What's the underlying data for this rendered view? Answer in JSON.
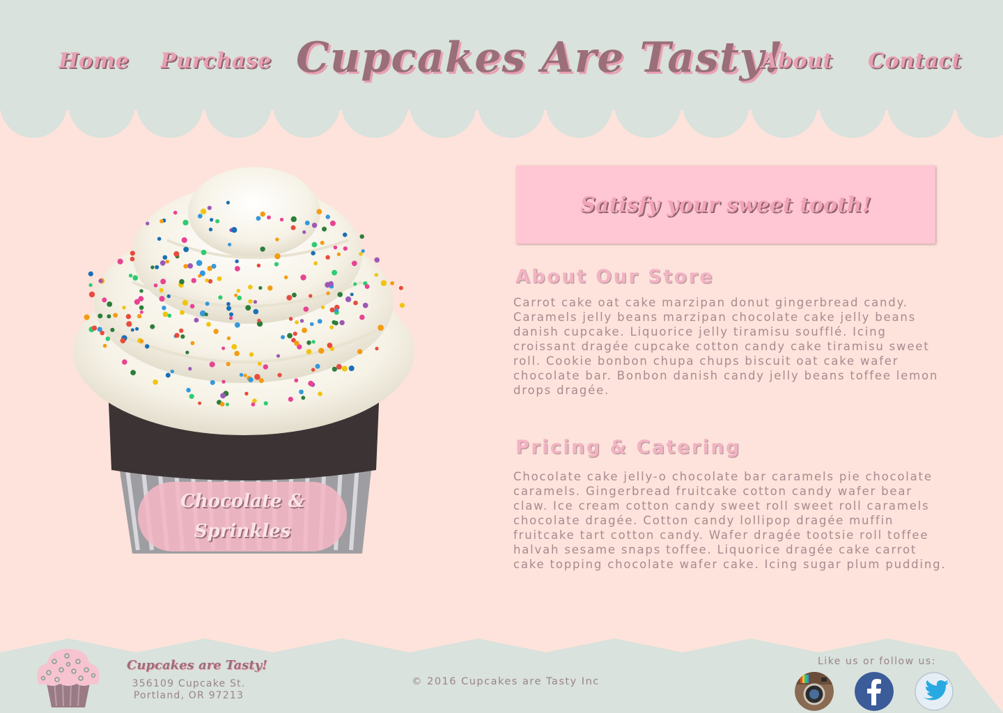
{
  "nav": {
    "home": "Home",
    "purchase": "Purchase",
    "about": "About",
    "contact": "Contact"
  },
  "site_title": "Cupcakes Are Tasty!",
  "hero": {
    "caption_line1": "Chocolate &",
    "caption_line2": "Sprinkles"
  },
  "banner_text": "Satisfy your sweet tooth!",
  "about": {
    "heading": "About Our Store",
    "lines": [
      "Carrot cake oat cake marzipan donut gingerbread candy.",
      "Caramels jelly beans marzipan chocolate cake jelly beans",
      "danish cupcake. Liquorice jelly tiramisu soufflé. Icing",
      "croissant dragée cupcake cotton candy cake tiramisu sweet",
      "roll. Cookie bonbon chupa chups biscuit oat cake wafer",
      "chocolate bar. Bonbon danish candy jelly beans toffee lemon",
      "drops dragée."
    ]
  },
  "pricing": {
    "heading": "Pricing & Catering",
    "lines": [
      "Chocolate cake jelly-o chocolate bar caramels pie chocolate",
      "caramels. Gingerbread fruitcake cotton candy wafer bear",
      "claw. Ice cream cotton candy sweet roll sweet roll caramels",
      "chocolate dragée. Cotton candy lollipop dragée muffin",
      "fruitcake tart cotton candy. Wafer dragée tootsie roll toffee",
      "halvah sesame snaps toffee. Liquorice dragée cake carrot",
      "cake topping chocolate wafer cake. Icing sugar plum pudding."
    ]
  },
  "footer": {
    "brand": "Cupcakes are Tasty!",
    "address_line1": "356109 Cupcake St.",
    "address_line2": "Portland, OR 97213",
    "copyright": "© 2016 Cupcakes are Tasty Inc",
    "follow_text": "Like us or follow us:"
  },
  "social_icons": [
    "instagram-icon",
    "facebook-icon",
    "twitter-icon"
  ],
  "colors": {
    "background": "#fde3db",
    "header_footer": "#d9e2dd",
    "accent_pink": "#ffc6d3",
    "title_mauve": "#9a6f79",
    "body_text": "#a88a90"
  }
}
